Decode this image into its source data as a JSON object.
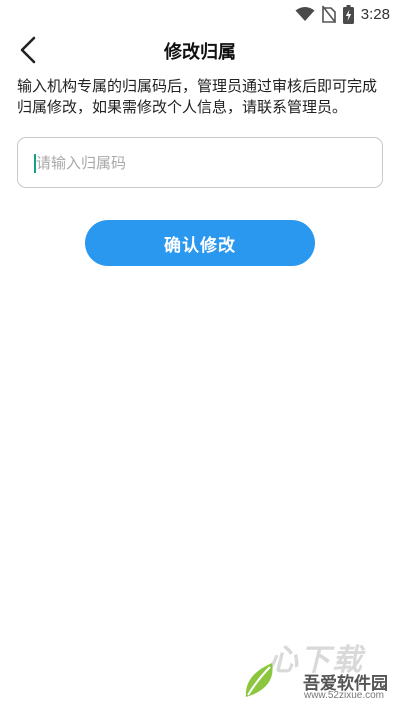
{
  "status_bar": {
    "time": "3:28",
    "icons": [
      "wifi-icon",
      "no-sim-icon",
      "battery-charging-icon"
    ]
  },
  "header": {
    "back_icon": "chevron-left-icon",
    "title": "修改归属"
  },
  "description": "输入机构专属的归属码后，管理员通过审核后即可完成归属修改，如果需修改个人信息，请联系管理员。",
  "form": {
    "code_input": {
      "value": "",
      "placeholder": "请输入归属码"
    },
    "confirm_label": "确认修改"
  },
  "watermark": {
    "big_text": "心下载",
    "name": "吾爱软件园",
    "url": "www.52zixue.com"
  },
  "colors": {
    "primary_button": "#2b98f0",
    "caret": "#13a08a",
    "input_border": "#c8c8c8"
  }
}
